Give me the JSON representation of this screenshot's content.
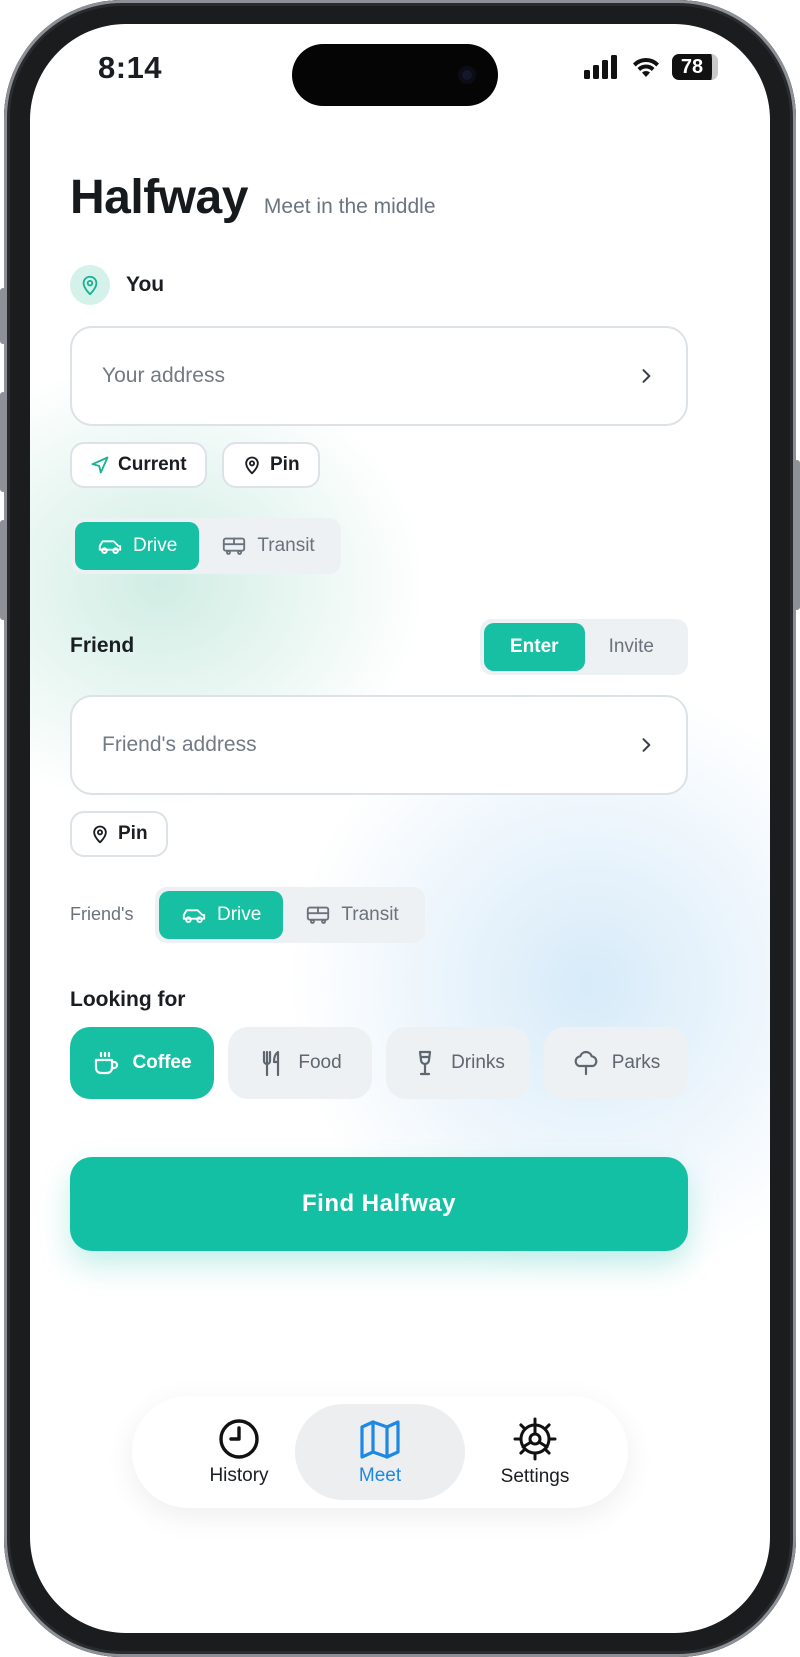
{
  "status_bar": {
    "time": "8:14",
    "battery": "78"
  },
  "header": {
    "title": "Halfway",
    "subtitle": "Meet in the middle"
  },
  "you": {
    "label": "You",
    "address_placeholder": "Your address",
    "current_label": "Current",
    "pin_label": "Pin",
    "modes": [
      {
        "label": "Drive",
        "active": true
      },
      {
        "label": "Transit",
        "active": false
      }
    ]
  },
  "friend": {
    "label": "Friend",
    "toggle": [
      {
        "label": "Enter",
        "active": true
      },
      {
        "label": "Invite",
        "active": false
      }
    ],
    "address_placeholder": "Friend's address",
    "pin_label": "Pin",
    "modes_label": "Friend's",
    "modes": [
      {
        "label": "Drive",
        "active": true
      },
      {
        "label": "Transit",
        "active": false
      }
    ]
  },
  "looking_for": {
    "label": "Looking for",
    "options": [
      {
        "label": "Coffee",
        "icon": "coffee-icon",
        "active": true
      },
      {
        "label": "Food",
        "icon": "utensils-icon",
        "active": false
      },
      {
        "label": "Drinks",
        "icon": "wine-icon",
        "active": false
      },
      {
        "label": "Parks",
        "icon": "tree-icon",
        "active": false
      }
    ]
  },
  "cta": {
    "label": "Find Halfway"
  },
  "tabbar": {
    "items": [
      {
        "label": "History",
        "icon": "clock-icon",
        "active": false
      },
      {
        "label": "Meet",
        "icon": "map-icon",
        "active": true
      },
      {
        "label": "Settings",
        "icon": "gear-icon",
        "active": false
      }
    ]
  },
  "colors": {
    "accent": "#17c0a3",
    "tab_active": "#1e88e5",
    "text": "#1a1d21",
    "muted": "#6a727c"
  }
}
